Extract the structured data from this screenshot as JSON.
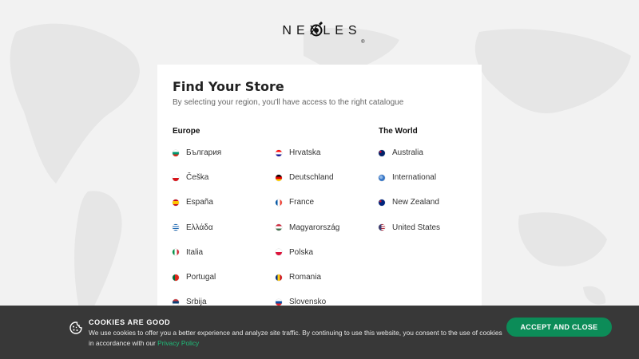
{
  "brand": {
    "name": "NEXLES",
    "registered": "®"
  },
  "store_finder": {
    "title": "Find Your Store",
    "subtitle": "By selecting your region, you'll have access to the right catalogue",
    "europe_heading": "Europe",
    "world_heading": "The World",
    "europe_col1": [
      {
        "label": "България",
        "flag": "bg"
      },
      {
        "label": "Češka",
        "flag": "cz"
      },
      {
        "label": "España",
        "flag": "es"
      },
      {
        "label": "Ελλάδα",
        "flag": "gr"
      },
      {
        "label": "Italia",
        "flag": "it"
      },
      {
        "label": "Portugal",
        "flag": "pt"
      },
      {
        "label": "Srbija",
        "flag": "rs"
      }
    ],
    "europe_col2": [
      {
        "label": "Hrvatska",
        "flag": "hr"
      },
      {
        "label": "Deutschland",
        "flag": "de"
      },
      {
        "label": "France",
        "flag": "fr"
      },
      {
        "label": "Magyarország",
        "flag": "hu"
      },
      {
        "label": "Polska",
        "flag": "pl"
      },
      {
        "label": "Romania",
        "flag": "ro"
      },
      {
        "label": "Slovensko",
        "flag": "sk"
      }
    ],
    "world_col": [
      {
        "label": "Australia",
        "flag": "au"
      },
      {
        "label": "International",
        "flag": "globe"
      },
      {
        "label": "New Zealand",
        "flag": "nz"
      },
      {
        "label": "United States",
        "flag": "us"
      }
    ]
  },
  "cookie_banner": {
    "title": "COOKIES ARE GOOD",
    "text": "We use cookies to offer you a better experience and analyze site traffic. By continuing to use this website, you consent to the use of cookies in accordance with our",
    "link_label": "Privacy Policy",
    "button_label": "ACCEPT AND CLOSE",
    "icon": "cookie-icon"
  },
  "colors": {
    "background": "#f2f2f2",
    "cookie_bar": "#383838",
    "accent_green": "#0c8c58",
    "link_green": "#1fbd7a"
  }
}
